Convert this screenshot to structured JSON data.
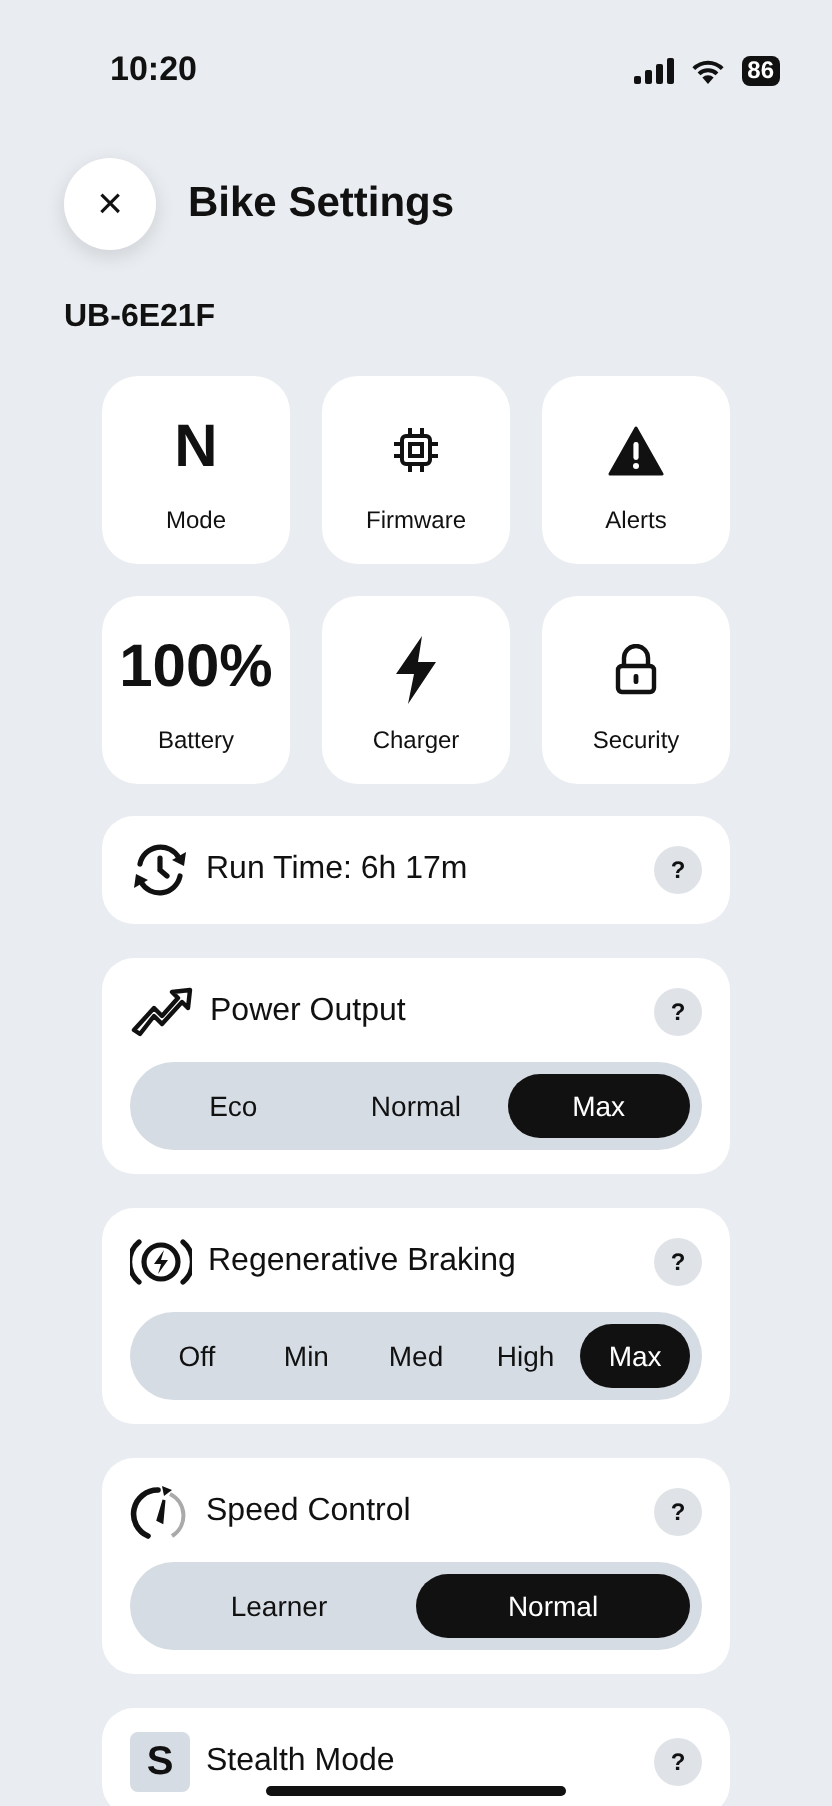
{
  "status_bar": {
    "time": "10:20",
    "battery": "86"
  },
  "header": {
    "close": "×",
    "title": "Bike Settings"
  },
  "device_id": "UB-6E21F",
  "tiles": [
    {
      "kind": "value",
      "value": "N",
      "label": "Mode"
    },
    {
      "kind": "icon",
      "label": "Firmware"
    },
    {
      "kind": "icon",
      "label": "Alerts"
    },
    {
      "kind": "value",
      "value": "100%",
      "label": "Battery"
    },
    {
      "kind": "icon",
      "label": "Charger"
    },
    {
      "kind": "icon",
      "label": "Security"
    }
  ],
  "cards": [
    {
      "title": "Run Time: 6h 17m",
      "help": "?"
    },
    {
      "title": "Power Output",
      "help": "?",
      "options": [
        {
          "label": "Eco",
          "selected": false
        },
        {
          "label": "Normal",
          "selected": false
        },
        {
          "label": "Max",
          "selected": true
        }
      ]
    },
    {
      "title": "Regenerative Braking",
      "help": "?",
      "options": [
        {
          "label": "Off",
          "selected": false
        },
        {
          "label": "Min",
          "selected": false
        },
        {
          "label": "Med",
          "selected": false
        },
        {
          "label": "High",
          "selected": false
        },
        {
          "label": "Max",
          "selected": true
        }
      ]
    },
    {
      "title": "Speed Control",
      "help": "?",
      "options": [
        {
          "label": "Learner",
          "selected": false
        },
        {
          "label": "Normal",
          "selected": true
        }
      ]
    },
    {
      "title": "Stealth Mode",
      "help": "?",
      "letter": "S"
    }
  ]
}
